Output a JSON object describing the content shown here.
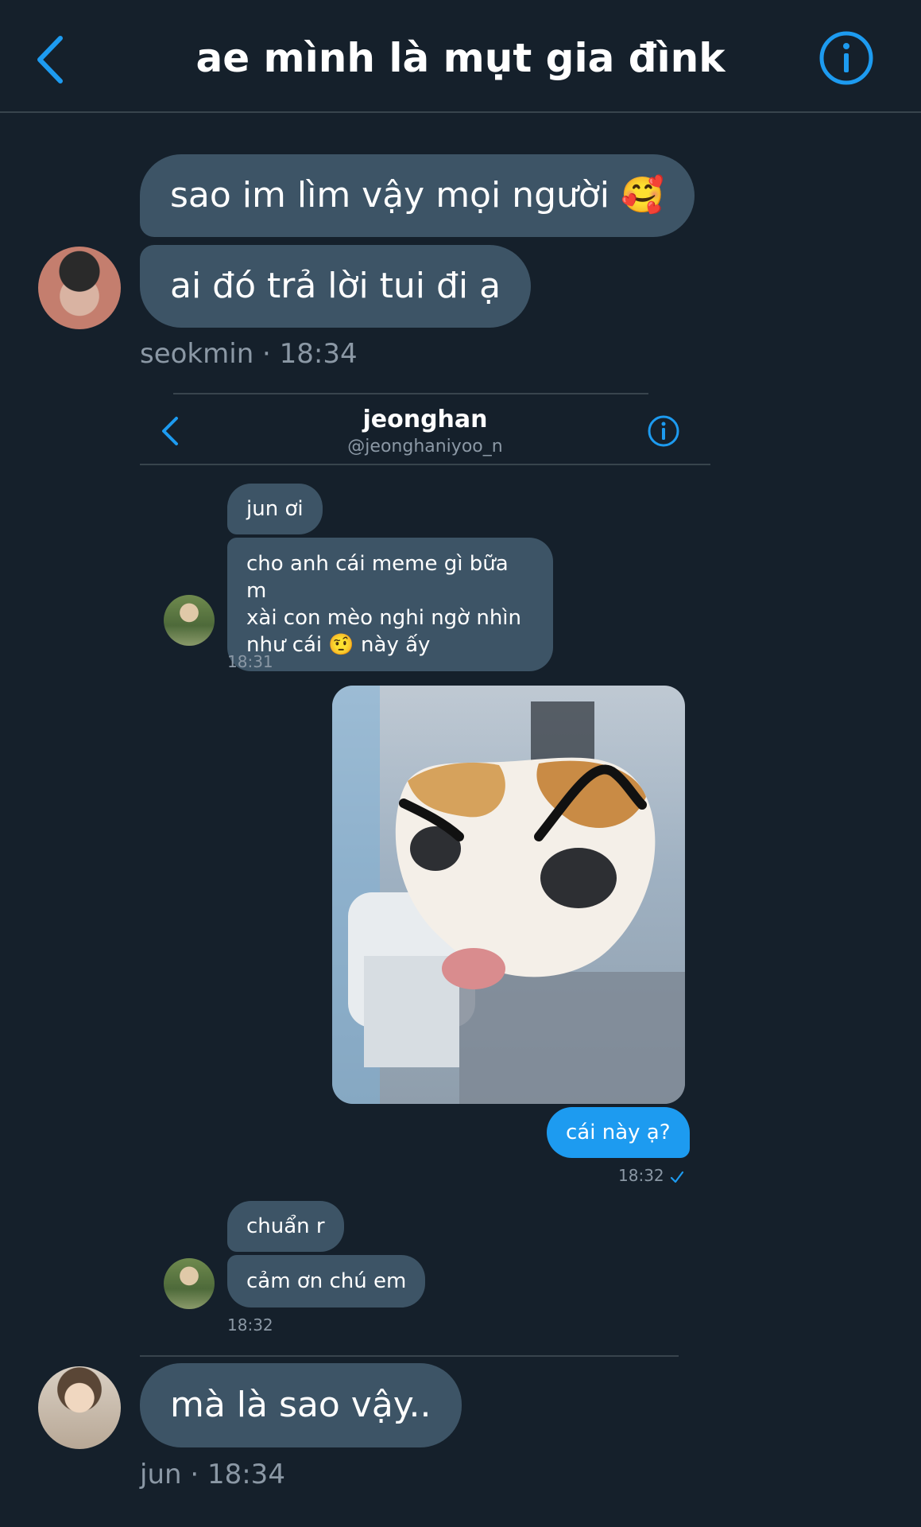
{
  "header": {
    "title": "ae mình là mụt gia đìnk",
    "back_icon": "chevron-left-icon",
    "info_icon": "info-circle-icon"
  },
  "messages_top": {
    "bubble1": "sao im lìm vậy mọi người 🥰",
    "bubble2": "ai đó trả lời tui đi ạ",
    "meta": "seokmin · 18:34"
  },
  "screenshot": {
    "name": "jeonghan",
    "handle": "@jeonghaniyoo_n",
    "msg1": "jun ơi",
    "msg2_line1": "cho anh cái meme gì bữa m",
    "msg2_line2": "xài con mèo nghi ngờ nhìn",
    "msg2_line3": "như cái 🤨 này ấy",
    "time1": "18:31",
    "reply": "cái này ạ?",
    "time2": "18:32",
    "msg3": "chuẩn r",
    "msg4": "cảm ơn chú em",
    "time3": "18:32"
  },
  "messages_bottom": {
    "bubble": "mà là sao vậy..",
    "meta": "jun · 18:34"
  },
  "colors": {
    "background": "#15202b",
    "bubble_received": "#3d5466",
    "bubble_sent": "#1d9bf0",
    "accent": "#1d9bf0",
    "muted_text": "#8b98a5"
  }
}
